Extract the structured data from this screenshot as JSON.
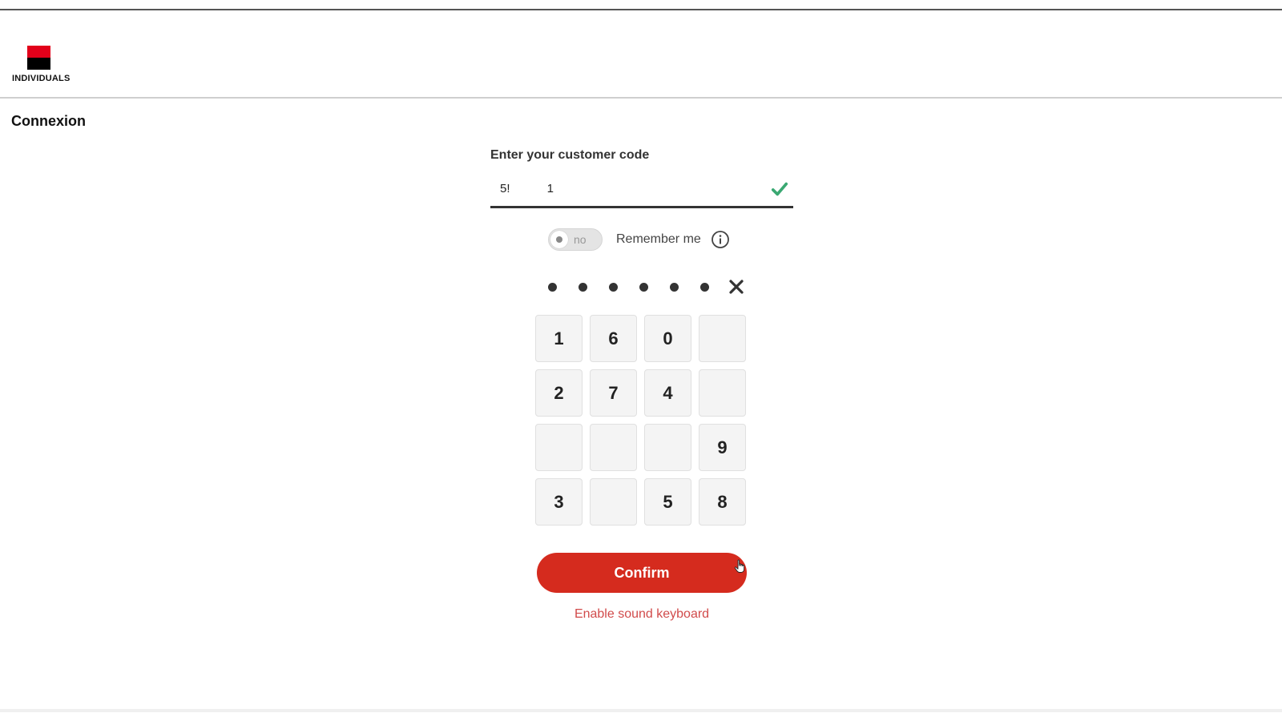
{
  "colors": {
    "brand_red": "#e2001a",
    "button_red": "#d52b1e",
    "link_red": "#d14b4b",
    "success_green": "#3aa872"
  },
  "header": {
    "brand_label": "INDIVIDUALS"
  },
  "page": {
    "title": "Connexion"
  },
  "login": {
    "customer_code_label": "Enter your customer code",
    "customer_code_value": "5! 1",
    "remember_toggle_state": "no",
    "remember_label": "Remember me",
    "pin_dots_entered": 6,
    "keypad": [
      "1",
      "6",
      "0",
      "",
      "2",
      "7",
      "4",
      "",
      "",
      "",
      "",
      "9",
      "3",
      "",
      "5",
      "8"
    ],
    "confirm_label": "Confirm",
    "sound_keyboard_link": "Enable sound keyboard"
  },
  "icons": {
    "logo": "brand-logo",
    "valid": "check-icon",
    "info": "info-icon",
    "clear": "close-icon",
    "pointer": "hand-cursor-icon"
  }
}
